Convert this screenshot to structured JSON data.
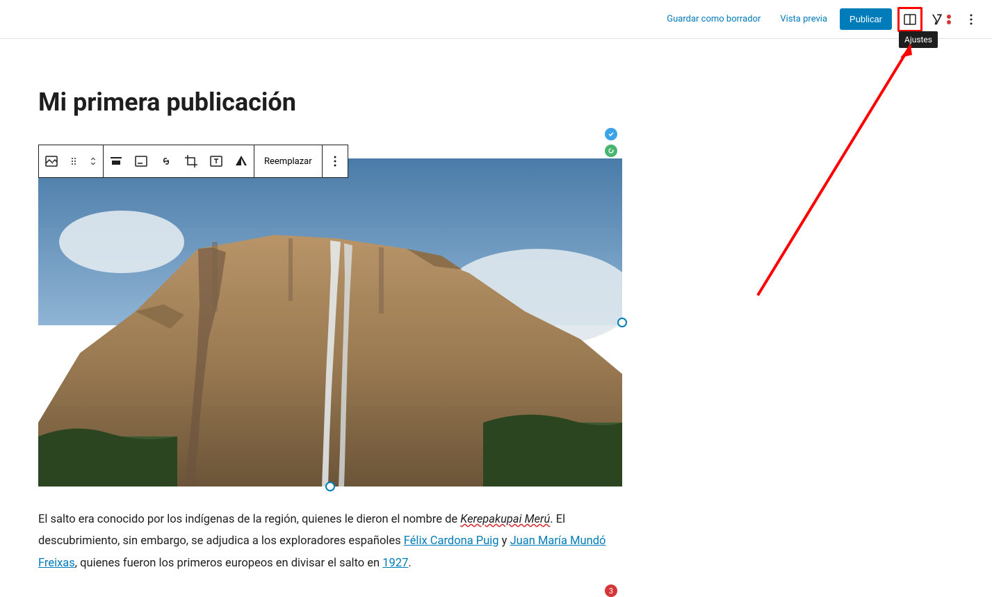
{
  "header": {
    "save_draft": "Guardar como borrador",
    "preview": "Vista previa",
    "publish": "Publicar",
    "settings_tooltip": "Ajustes"
  },
  "post": {
    "title": "Mi primera publicación"
  },
  "toolbar": {
    "replace": "Reemplazar"
  },
  "content": {
    "p1_a": "El salto era conocido por los indígenas de la región, quienes le dieron el nombre de ",
    "p1_term": "Kerepakupai Merú",
    "p1_b": ". El descubrimiento, sin embargo, se adjudica a los exploradores españoles ",
    "link1": "Félix Cardona Puig",
    "p1_c": " y ",
    "link2": "Juan María Mundó Freixas",
    "p1_d": ", quienes fueron los primeros europeos en divisar el salto en ",
    "link3": "1927",
    "p1_e": "."
  },
  "badges": {
    "error_count": "3"
  }
}
